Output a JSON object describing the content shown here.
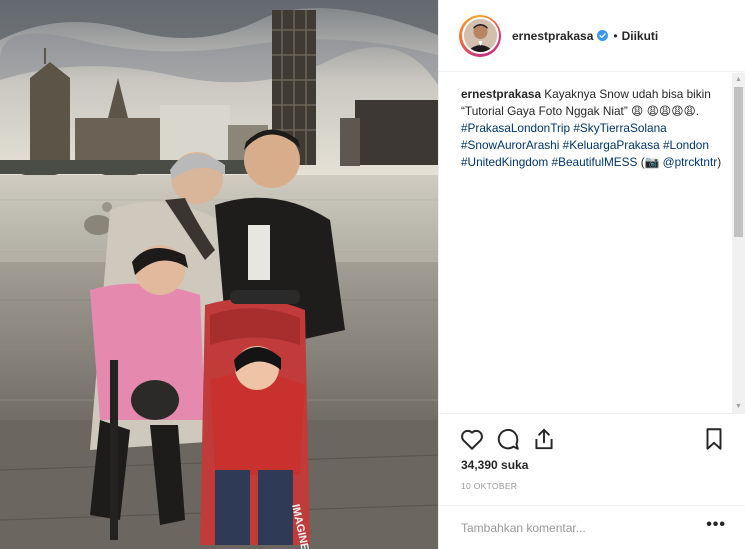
{
  "post": {
    "username": "ernestprakasa",
    "follow_status": "Diikuti",
    "separator": "•",
    "caption_segments": [
      {
        "text": "ernestprakasa",
        "kind": "user"
      },
      {
        "text": " Kayaknya Snow udah bisa bikin “Tutorial Gaya Foto Nggak Niat” 😩 😩😩😩😩. ",
        "kind": "text"
      },
      {
        "text": "#PrakasaLondonTrip",
        "kind": "tag"
      },
      {
        "text": " ",
        "kind": "text"
      },
      {
        "text": "#SkyTierraSolana",
        "kind": "tag"
      },
      {
        "text": " ",
        "kind": "text"
      },
      {
        "text": "#SnowAurorArashi",
        "kind": "tag"
      },
      {
        "text": " ",
        "kind": "text"
      },
      {
        "text": "#KeluargaPrakasa",
        "kind": "tag"
      },
      {
        "text": " ",
        "kind": "text"
      },
      {
        "text": "#London",
        "kind": "tag"
      },
      {
        "text": " ",
        "kind": "text"
      },
      {
        "text": "#UnitedKingdom",
        "kind": "tag"
      },
      {
        "text": " ",
        "kind": "text"
      },
      {
        "text": "#BeautifulMESS",
        "kind": "tag"
      },
      {
        "text": " (📷 ",
        "kind": "text"
      },
      {
        "text": "@ptrcktntr",
        "kind": "tag"
      },
      {
        "text": ")",
        "kind": "text"
      }
    ],
    "likes": "34,390 suka",
    "date": "10 OKTOBER",
    "comment_placeholder": "Tambahkan komentar...",
    "more_label": "•••"
  },
  "icons": {
    "avatar": "profile-avatar",
    "verified": "verified-badge-icon",
    "like": "heart-icon",
    "comment": "comment-bubble-icon",
    "share": "share-icon",
    "save": "bookmark-icon",
    "photo_sign": "IMAGINE BEL"
  },
  "colors": {
    "text": "#262626",
    "hashtag": "#003569",
    "muted": "#999999",
    "verified": "#3897f0",
    "border": "#efefef"
  }
}
